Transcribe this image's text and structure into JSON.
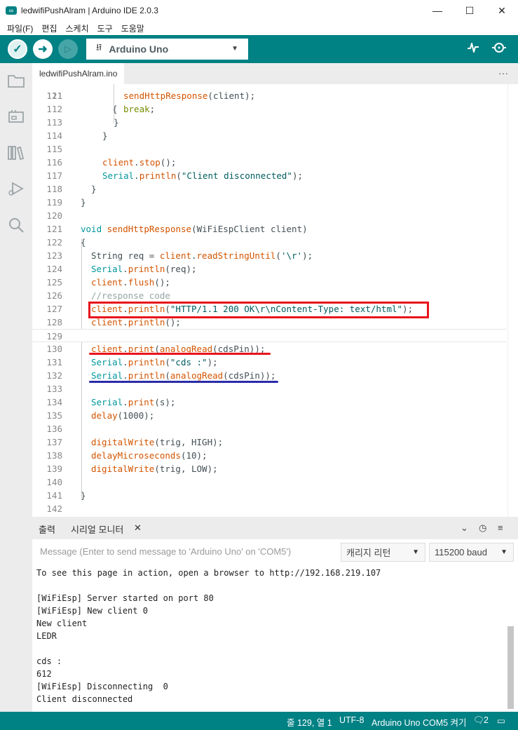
{
  "window": {
    "title": "ledwifiPushAlram | Arduino IDE 2.0.3",
    "app_icon": "infinity-icon",
    "minimize": "—",
    "maximize": "☐",
    "close": "✕"
  },
  "menu": [
    "파일(F)",
    "편집",
    "스케치",
    "도구",
    "도움말"
  ],
  "toolbar": {
    "verify_icon": "check-icon",
    "upload_icon": "arrow-right-icon",
    "debug_icon": "debug-icon",
    "board": "Arduino Uno",
    "plotter_icon": "serial-plotter-icon",
    "monitor_icon": "serial-monitor-icon"
  },
  "sidebar_icons": [
    "folder-icon",
    "board-icon",
    "library-icon",
    "debug-icon",
    "search-icon"
  ],
  "tab": {
    "filename": "ledwifiPushAlram.ino",
    "more": "···"
  },
  "editor": {
    "lines": [
      {
        "n": "111",
        "html": "<span class=\"kw-fn\">sendHttpResponse</span>(client);"
      },
      {
        "n": "112",
        "html": "<span class=\"kw-ctl\">break</span>;"
      },
      {
        "n": "113",
        "html": "}"
      },
      {
        "n": "114",
        "html": "}"
      },
      {
        "n": "115",
        "html": ""
      },
      {
        "n": "116",
        "html": "<span class=\"kw-fn\">client</span>.<span class=\"kw-fn\">stop</span>();"
      },
      {
        "n": "117",
        "html": "<span class=\"kw-ty\">Serial</span>.<span class=\"kw-fn\">println</span>(<span class=\"str\">\"Client disconnected\"</span>);"
      },
      {
        "n": "118",
        "html": "}"
      },
      {
        "n": "119",
        "html": "}"
      },
      {
        "n": "120",
        "html": ""
      },
      {
        "n": "121",
        "html": "<span class=\"kw-ty\">void</span> <span class=\"kw-fn\">sendHttpResponse</span>(WiFiEspClient client)"
      },
      {
        "n": "122",
        "html": "{"
      },
      {
        "n": "123",
        "html": "String req = <span class=\"kw-fn\">client</span>.<span class=\"kw-fn\">readStringUntil</span>(<span class=\"str\">'\\r'</span>);"
      },
      {
        "n": "124",
        "html": "<span class=\"kw-ty\">Serial</span>.<span class=\"kw-fn\">println</span>(req);"
      },
      {
        "n": "125",
        "html": "<span class=\"kw-fn\">client</span>.<span class=\"kw-fn\">flush</span>();"
      },
      {
        "n": "126",
        "html": "<span class=\"cmt\">//response code</span>"
      },
      {
        "n": "127",
        "html": "<span class=\"kw-fn\">client</span>.<span class=\"kw-fn\">println</span>(<span class=\"str\">\"HTTP/1.1 200 OK\\r\\nContent-Type: text/html\"</span>);"
      },
      {
        "n": "128",
        "html": "<span class=\"kw-fn\">client</span>.<span class=\"kw-fn\">println</span>();"
      },
      {
        "n": "129",
        "html": ""
      },
      {
        "n": "130",
        "html": "<span class=\"kw-fn\">client</span>.<span class=\"kw-fn\">print</span>(<span class=\"kw-fn\">analogRead</span>(cdsPin));"
      },
      {
        "n": "131",
        "html": "<span class=\"kw-ty\">Serial</span>.<span class=\"kw-fn\">println</span>(<span class=\"str\">\"cds :\"</span>);"
      },
      {
        "n": "132",
        "html": "<span class=\"kw-ty\">Serial</span>.<span class=\"kw-fn\">println</span>(<span class=\"kw-fn\">analogRead</span>(cdsPin));"
      },
      {
        "n": "133",
        "html": ""
      },
      {
        "n": "134",
        "html": "<span class=\"kw-ty\">Serial</span>.<span class=\"kw-fn\">print</span>(s);"
      },
      {
        "n": "135",
        "html": "<span class=\"kw-fn\">delay</span>(1000);"
      },
      {
        "n": "136",
        "html": ""
      },
      {
        "n": "137",
        "html": "<span class=\"kw-fn\">digitalWrite</span>(trig, HIGH);"
      },
      {
        "n": "138",
        "html": "<span class=\"kw-fn\">delayMicroseconds</span>(10);"
      },
      {
        "n": "139",
        "html": "<span class=\"kw-fn\">digitalWrite</span>(trig, LOW);"
      },
      {
        "n": "140",
        "html": ""
      },
      {
        "n": "141",
        "html": "}"
      },
      {
        "n": "142",
        "html": ""
      }
    ]
  },
  "panel": {
    "tab_output": "출력",
    "tab_serial": "시리얼 모니터",
    "close": "✕"
  },
  "serial_monitor": {
    "message_placeholder": "Message (Enter to send message to 'Arduino Uno' on 'COM5')",
    "line_ending": "캐리지 리턴",
    "baud": "115200 baud",
    "output": [
      "To see this page in action, open a browser to http://192.168.219.107",
      "",
      "[WiFiEsp] Server started on port 80",
      "[WiFiEsp] New client 0",
      "New client",
      "LEDR",
      "",
      "cds :",
      "612",
      "[WiFiEsp] Disconnecting  0",
      "Client disconnected"
    ]
  },
  "status": {
    "position": "줄 129, 열 1",
    "encoding": "UTF-8",
    "board": "Arduino Uno COM5 켜기",
    "notifications": "2"
  },
  "colors": {
    "accent": "#008184",
    "annotation_red": "#e8141c",
    "annotation_blue": "#2b2ba8"
  }
}
